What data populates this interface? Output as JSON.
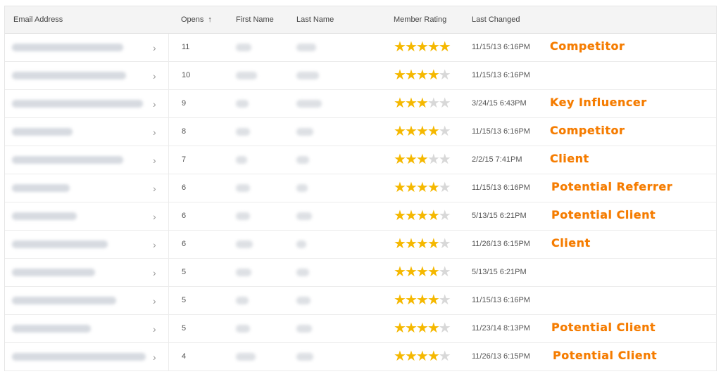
{
  "table": {
    "headers": {
      "email": "Email Address",
      "opens": "Opens",
      "first_name": "First Name",
      "last_name": "Last Name",
      "rating": "Member Rating",
      "changed": "Last Changed"
    },
    "sort_icon": "arrow-up-icon",
    "rows": [
      {
        "opens": "11",
        "rating": 5,
        "changed": "11/15/13 6:16PM",
        "tag": "Competitor"
      },
      {
        "opens": "10",
        "rating": 4,
        "changed": "11/15/13 6:16PM",
        "tag": ""
      },
      {
        "opens": "9",
        "rating": 3,
        "changed": "3/24/15 6:43PM",
        "tag": "Key Influencer"
      },
      {
        "opens": "8",
        "rating": 4,
        "changed": "11/15/13 6:16PM",
        "tag": "Competitor"
      },
      {
        "opens": "7",
        "rating": 3,
        "changed": "2/2/15 7:41PM",
        "tag": "Client"
      },
      {
        "opens": "6",
        "rating": 4,
        "changed": "11/15/13 6:16PM",
        "tag": "Potential Referrer"
      },
      {
        "opens": "6",
        "rating": 4,
        "changed": "5/13/15 6:21PM",
        "tag": "Potential Client"
      },
      {
        "opens": "6",
        "rating": 4,
        "changed": "11/26/13 6:15PM",
        "tag": "Client"
      },
      {
        "opens": "5",
        "rating": 4,
        "changed": "5/13/15 6:21PM",
        "tag": ""
      },
      {
        "opens": "5",
        "rating": 4,
        "changed": "11/15/13 6:16PM",
        "tag": ""
      },
      {
        "opens": "5",
        "rating": 4,
        "changed": "11/23/14 8:13PM",
        "tag": "Potential Client"
      },
      {
        "opens": "4",
        "rating": 4,
        "changed": "11/26/13 6:15PM",
        "tag": "Potential Client"
      }
    ]
  },
  "colors": {
    "star_on": "#f5b800",
    "star_off": "#d8d8d8",
    "tag": "#f57c00",
    "header_bg": "#f4f4f4"
  }
}
